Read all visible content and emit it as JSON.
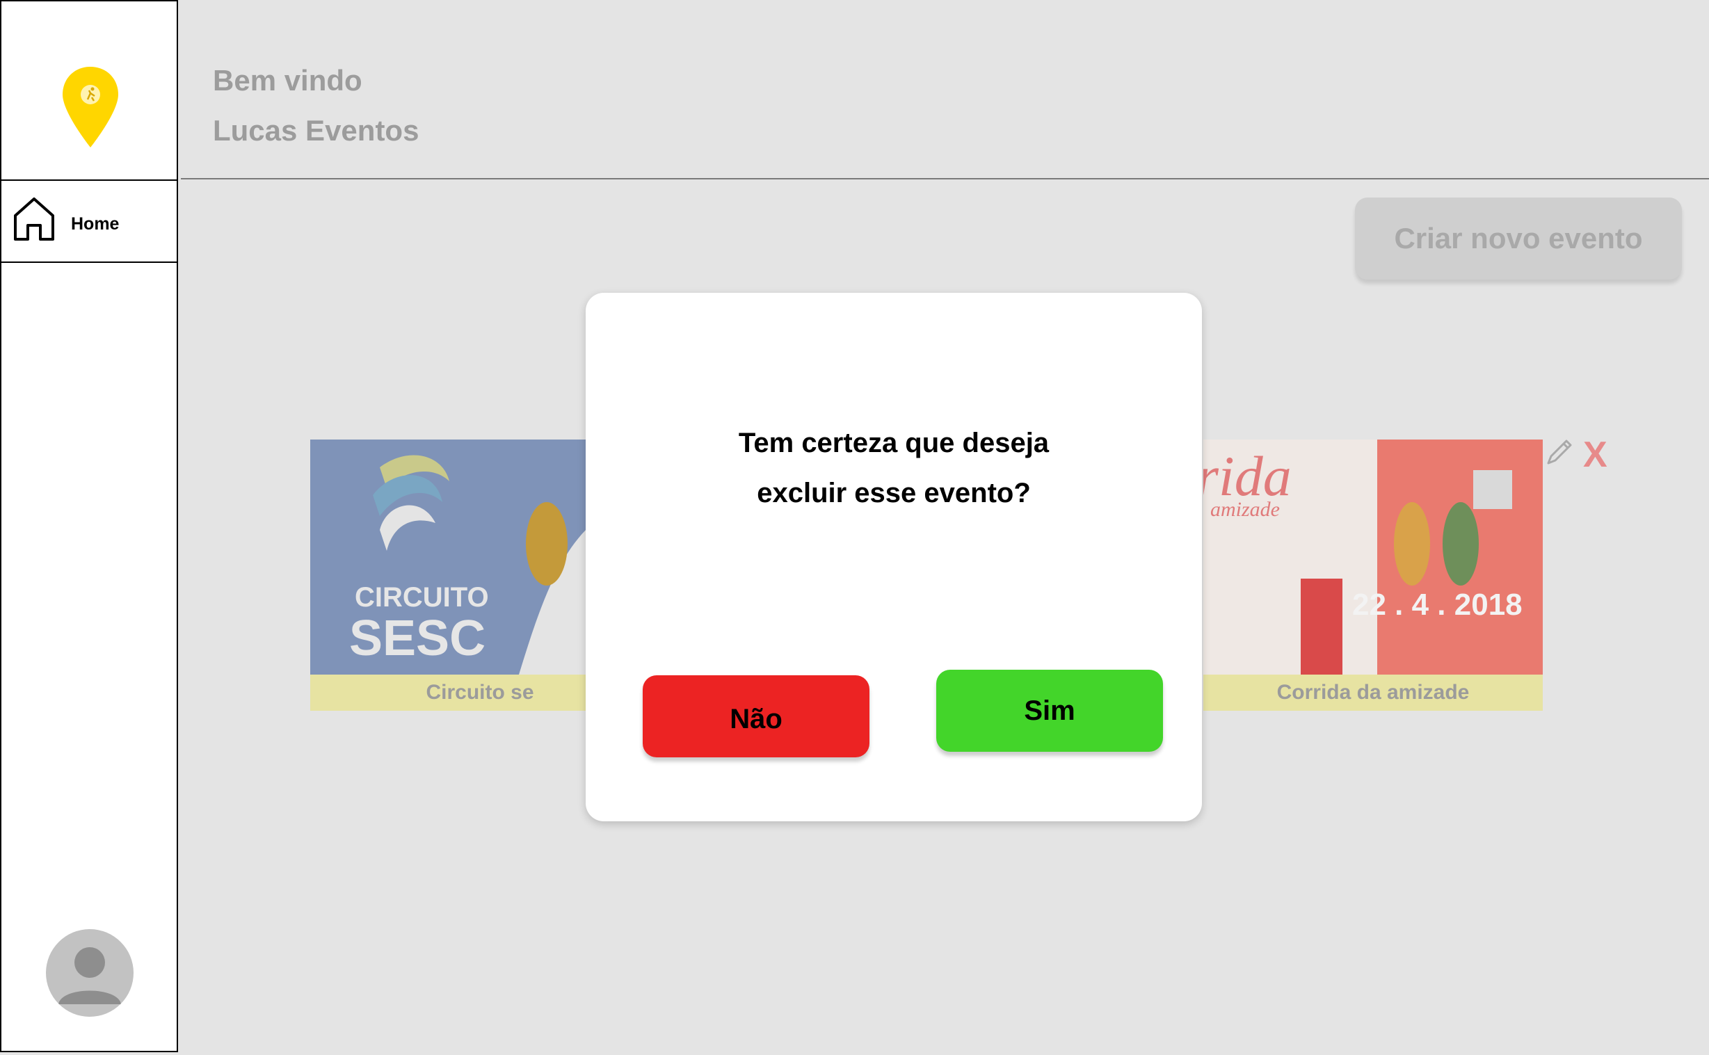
{
  "sidebar": {
    "logo_icon": "location-pin-runner-icon",
    "nav": [
      {
        "label": "Home",
        "icon": "home-icon"
      }
    ],
    "avatar_icon": "user-avatar-icon"
  },
  "header": {
    "greeting": "Bem vindo",
    "user_name": "Lucas Eventos"
  },
  "toolbar": {
    "create_event_label": "Criar novo evento"
  },
  "events": [
    {
      "caption": "Circuito se",
      "image_text": [
        "CIRCUITO",
        "SESC"
      ]
    },
    {
      "caption": "Corrida da amizade",
      "image_text": [
        "rida",
        "amizade",
        "22 . 4 . 2018"
      ]
    }
  ],
  "card_actions": {
    "edit_icon": "pencil-icon",
    "delete_label": "X"
  },
  "modal": {
    "message_line1": "Tem certeza que deseja",
    "message_line2": "excluir esse evento?",
    "no_label": "Não",
    "yes_label": "Sim"
  },
  "colors": {
    "accent_yellow": "#FFD600",
    "no_red": "#EC2323",
    "yes_green": "#43D52A"
  }
}
